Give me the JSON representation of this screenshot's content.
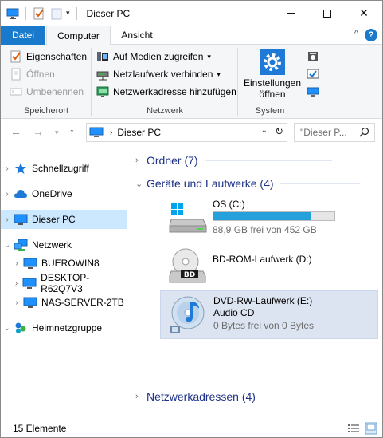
{
  "window": {
    "title": "Dieser PC",
    "controls": {
      "minimize": "—",
      "maximize": "□",
      "close": "✕"
    }
  },
  "ribbon": {
    "tabs": [
      {
        "label": "Datei"
      },
      {
        "label": "Computer"
      },
      {
        "label": "Ansicht"
      }
    ],
    "help": "?",
    "groups": {
      "speicherort": {
        "label": "Speicherort",
        "eigenschaften": "Eigenschaften",
        "oeffnen": "Öffnen",
        "umbenennen": "Umbenennen"
      },
      "netzwerk": {
        "label": "Netzwerk",
        "medien": "Auf Medien zugreifen",
        "laufwerk": "Netzlaufwerk verbinden",
        "adresse": "Netzwerkadresse hinzufügen"
      },
      "system": {
        "label": "System",
        "einstellungen_line1": "Einstellungen",
        "einstellungen_line2": "öffnen"
      }
    }
  },
  "address": {
    "crumb": "Dieser PC",
    "search_placeholder": "\"Dieser P..."
  },
  "nav": {
    "items": [
      {
        "label": "Schnellzugriff"
      },
      {
        "label": "OneDrive"
      },
      {
        "label": "Dieser PC"
      },
      {
        "label": "Netzwerk"
      },
      {
        "label": "BUEROWIN8"
      },
      {
        "label": "DESKTOP-R62Q7V3"
      },
      {
        "label": "NAS-SERVER-2TB"
      },
      {
        "label": "Heimnetzgruppe"
      }
    ]
  },
  "content": {
    "groups": {
      "ordner": "Ordner (7)",
      "geraete": "Geräte und Laufwerke (4)",
      "netzwerkadressen": "Netzwerkadressen (4)"
    },
    "drives": [
      {
        "name": "OS (C:)",
        "free": "88,9 GB frei von 452 GB",
        "used_fraction": 0.8
      },
      {
        "name": "BD-ROM-Laufwerk (D:)"
      },
      {
        "name": "DVD-RW-Laufwerk (E:)",
        "label": "Audio CD",
        "free": "0 Bytes frei von 0 Bytes"
      }
    ]
  },
  "status": {
    "count": "15 Elemente"
  },
  "colors": {
    "accent": "#1979ca",
    "selection": "#cce8ff",
    "group_header": "#1e3287",
    "progress": "#26a0da"
  }
}
